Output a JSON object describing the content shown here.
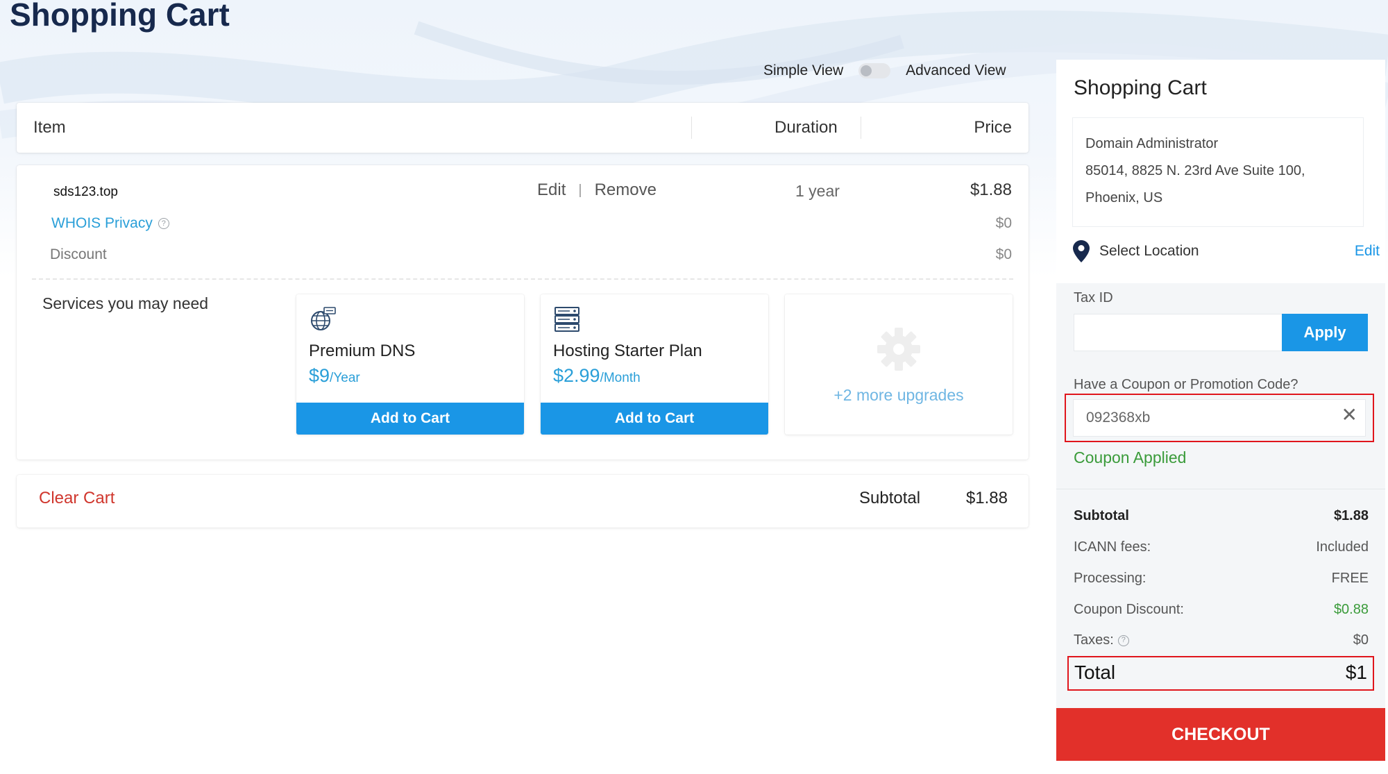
{
  "page": {
    "title": "Shopping Cart"
  },
  "view_toggle": {
    "simple_label": "Simple View",
    "advanced_label": "Advanced View"
  },
  "table_header": {
    "item": "Item",
    "duration": "Duration",
    "price": "Price"
  },
  "cart_item": {
    "domain": "sds123.top",
    "edit_label": "Edit",
    "separator": "|",
    "remove_label": "Remove",
    "duration": "1 year",
    "price": "$1.88",
    "whois_label": "WHOIS Privacy",
    "whois_price": "$0",
    "discount_label": "Discount",
    "discount_price": "$0"
  },
  "services": {
    "label": "Services you may need",
    "items": [
      {
        "name": "Premium DNS",
        "price": "$9",
        "unit": "/Year",
        "button": "Add to Cart",
        "icon": "dns-globe-icon"
      },
      {
        "name": "Hosting Starter Plan",
        "price": "$2.99",
        "unit": "/Month",
        "button": "Add to Cart",
        "icon": "server-icon"
      }
    ],
    "more_label": "+2 more upgrades"
  },
  "cart_footer": {
    "clear_label": "Clear Cart",
    "subtotal_label": "Subtotal",
    "subtotal_value": "$1.88"
  },
  "sidebar": {
    "title": "Shopping Cart",
    "address": {
      "line1": "Domain Administrator",
      "line2": "85014, 8825 N. 23rd Ave Suite 100,",
      "line3": "Phoenix, US"
    },
    "location_label": "Select Location",
    "location_edit": "Edit",
    "tax_label": "Tax ID",
    "tax_value": "",
    "apply_label": "Apply",
    "coupon_label": "Have a Coupon or Promotion Code?",
    "coupon_value": "092368xb",
    "coupon_clear": "✕",
    "coupon_status": "Coupon Applied",
    "summary": {
      "subtotal_label": "Subtotal",
      "subtotal_value": "$1.88",
      "icann_label": "ICANN fees:",
      "icann_value": "Included",
      "processing_label": "Processing:",
      "processing_value": "FREE",
      "coupon_discount_label": "Coupon Discount:",
      "coupon_discount_value": "$0.88",
      "taxes_label": "Taxes:",
      "taxes_value": "$0",
      "total_label": "Total",
      "total_value": "$1"
    },
    "checkout_label": "CHECKOUT"
  },
  "colors": {
    "title": "#17294d",
    "accent_blue": "#1a96e6",
    "link_blue": "#2a9fd8",
    "danger_red": "#e2302a",
    "success_green": "#3a9b3a",
    "highlight_border": "#e0151c"
  }
}
